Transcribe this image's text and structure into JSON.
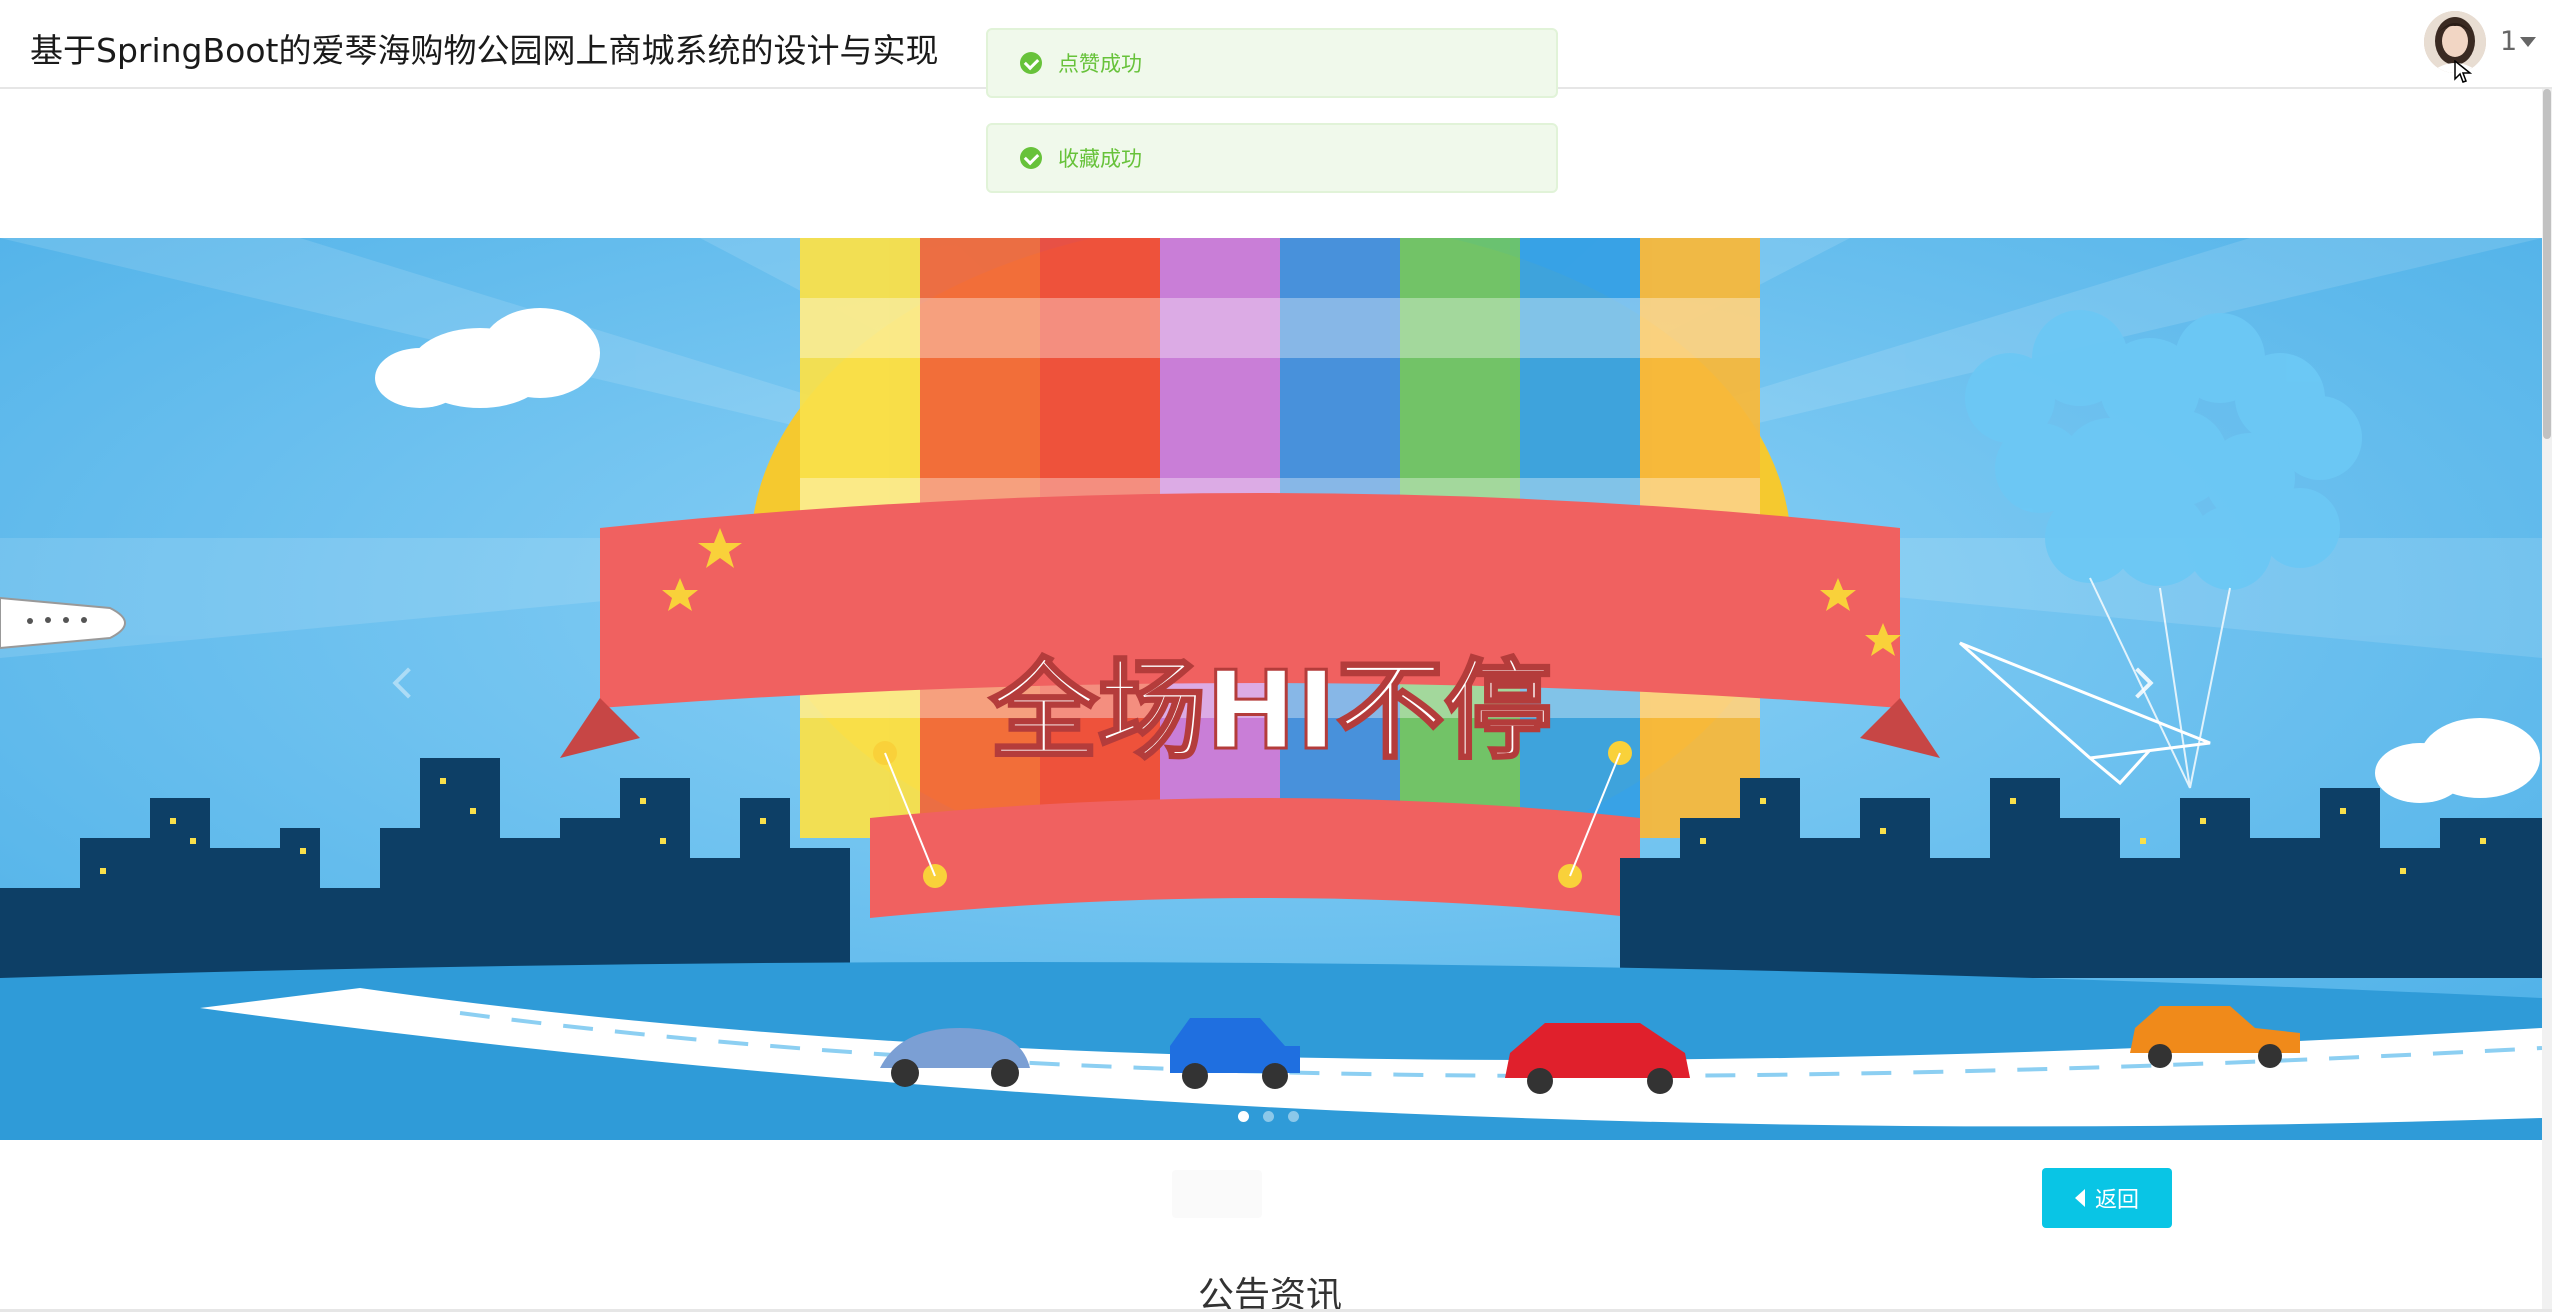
{
  "header": {
    "title": "基于SpringBoot的爱琴海购物公园网上商城系统的设计与实现",
    "user": {
      "name": "1",
      "avatar_icon": "avatar-photo",
      "dropdown_icon": "caret-down-icon"
    }
  },
  "toasts": [
    {
      "message": "点赞成功",
      "type": "success",
      "icon": "check-circle-icon",
      "color": "#67c23a"
    },
    {
      "message": "收藏成功",
      "type": "success",
      "icon": "check-circle-icon",
      "color": "#67c23a"
    }
  ],
  "carousel": {
    "banner_text": "全场HI不停",
    "prev_icon": "chevron-left-icon",
    "next_icon": "chevron-right-icon",
    "slide_count": 3,
    "active_index": 0
  },
  "actions": {
    "back_label": "返回",
    "back_color": "#09c5e5"
  },
  "section": {
    "title": "公告资讯"
  }
}
